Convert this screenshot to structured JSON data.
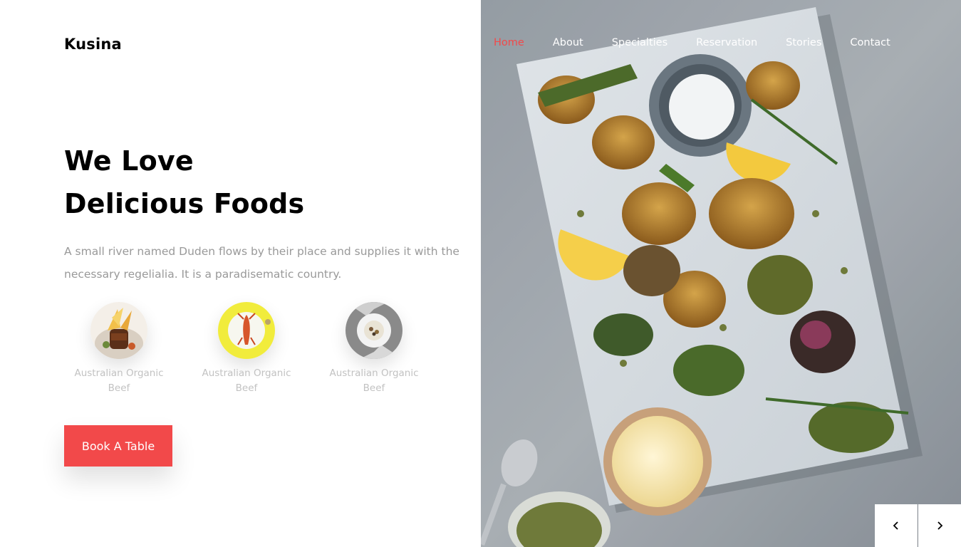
{
  "brand": {
    "name": "Kusina"
  },
  "nav": {
    "items": [
      {
        "label": "Home",
        "active": true
      },
      {
        "label": "About"
      },
      {
        "label": "Specialties"
      },
      {
        "label": "Reservation"
      },
      {
        "label": "Stories"
      },
      {
        "label": "Contact"
      }
    ]
  },
  "hero": {
    "title_line1": "We Love",
    "title_line2": "Delicious Foods",
    "text": "A small river named Duden flows by their place and supplies it with the necessary regelialia. It is a paradisematic country."
  },
  "dishes": [
    {
      "label": "Australian Organic Beef",
      "icon": "dish-photo-icon"
    },
    {
      "label": "Australian Organic Beef",
      "icon": "dish-photo-icon"
    },
    {
      "label": "Australian Organic Beef",
      "icon": "dish-photo-icon"
    }
  ],
  "cta": {
    "label": "Book A Table"
  },
  "slider": {
    "prev_icon": "chevron-left-icon",
    "next_icon": "chevron-right-icon"
  },
  "colors": {
    "accent": "#f2494a",
    "text_dark": "#000000",
    "text_muted": "#999999"
  }
}
